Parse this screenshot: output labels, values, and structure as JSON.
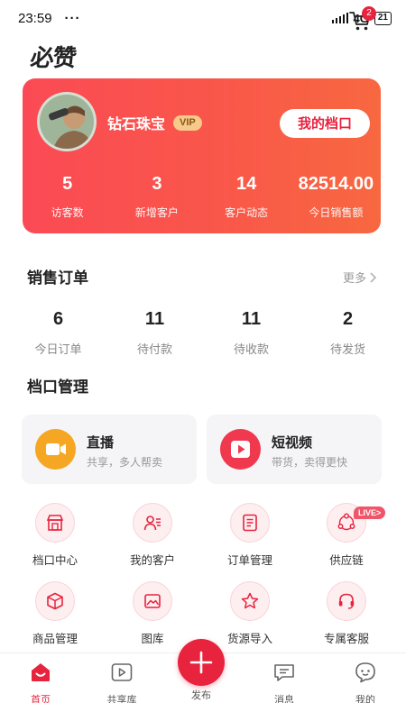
{
  "status_bar": {
    "time": "23:59",
    "dots": "···",
    "network": "4G",
    "network_sub": "ıl",
    "battery": "21"
  },
  "header": {
    "logo": "必赞",
    "cart_badge": "2"
  },
  "profile": {
    "name": "钻石珠宝",
    "vip": "VIP",
    "stall_button": "我的档口",
    "stats": [
      {
        "value": "5",
        "label": "访客数"
      },
      {
        "value": "3",
        "label": "新增客户"
      },
      {
        "value": "14",
        "label": "客户动态"
      },
      {
        "value": "82514.00",
        "label": "今日销售额"
      }
    ]
  },
  "sales_orders": {
    "title": "销售订单",
    "more": "更多",
    "items": [
      {
        "value": "6",
        "label": "今日订单"
      },
      {
        "value": "11",
        "label": "待付款"
      },
      {
        "value": "11",
        "label": "待收款"
      },
      {
        "value": "2",
        "label": "待发货"
      }
    ]
  },
  "stall_management": {
    "title": "档口管理",
    "features": [
      {
        "title": "直播",
        "subtitle": "共享，多人帮卖",
        "icon": "video-camera-icon",
        "color": "#f5a623"
      },
      {
        "title": "短视频",
        "subtitle": "带货，卖得更快",
        "icon": "play-icon",
        "color": "#f0394f"
      }
    ],
    "grid": [
      {
        "label": "档口中心",
        "icon": "store-icon"
      },
      {
        "label": "我的客户",
        "icon": "customer-icon"
      },
      {
        "label": "订单管理",
        "icon": "order-icon"
      },
      {
        "label": "供应链",
        "icon": "network-icon"
      },
      {
        "label": "商品管理",
        "icon": "box-icon"
      },
      {
        "label": "图库",
        "icon": "image-icon"
      },
      {
        "label": "货源导入",
        "icon": "star-icon"
      },
      {
        "label": "专属客服",
        "icon": "headset-icon"
      }
    ],
    "live_badge": "LIVE>"
  },
  "bottom_nav": {
    "items": [
      {
        "label": "首页",
        "icon": "home-icon",
        "active": true
      },
      {
        "label": "共享库",
        "icon": "play-box-icon",
        "active": false
      },
      {
        "label": "消息",
        "icon": "message-icon",
        "active": false
      },
      {
        "label": "我的",
        "icon": "profile-icon",
        "active": false
      }
    ],
    "publish_label": "发布"
  },
  "colors": {
    "accent": "#e8233e",
    "card_gradient_start": "#fb4a55",
    "card_gradient_end": "#f86840",
    "live_orange": "#f5a623"
  }
}
